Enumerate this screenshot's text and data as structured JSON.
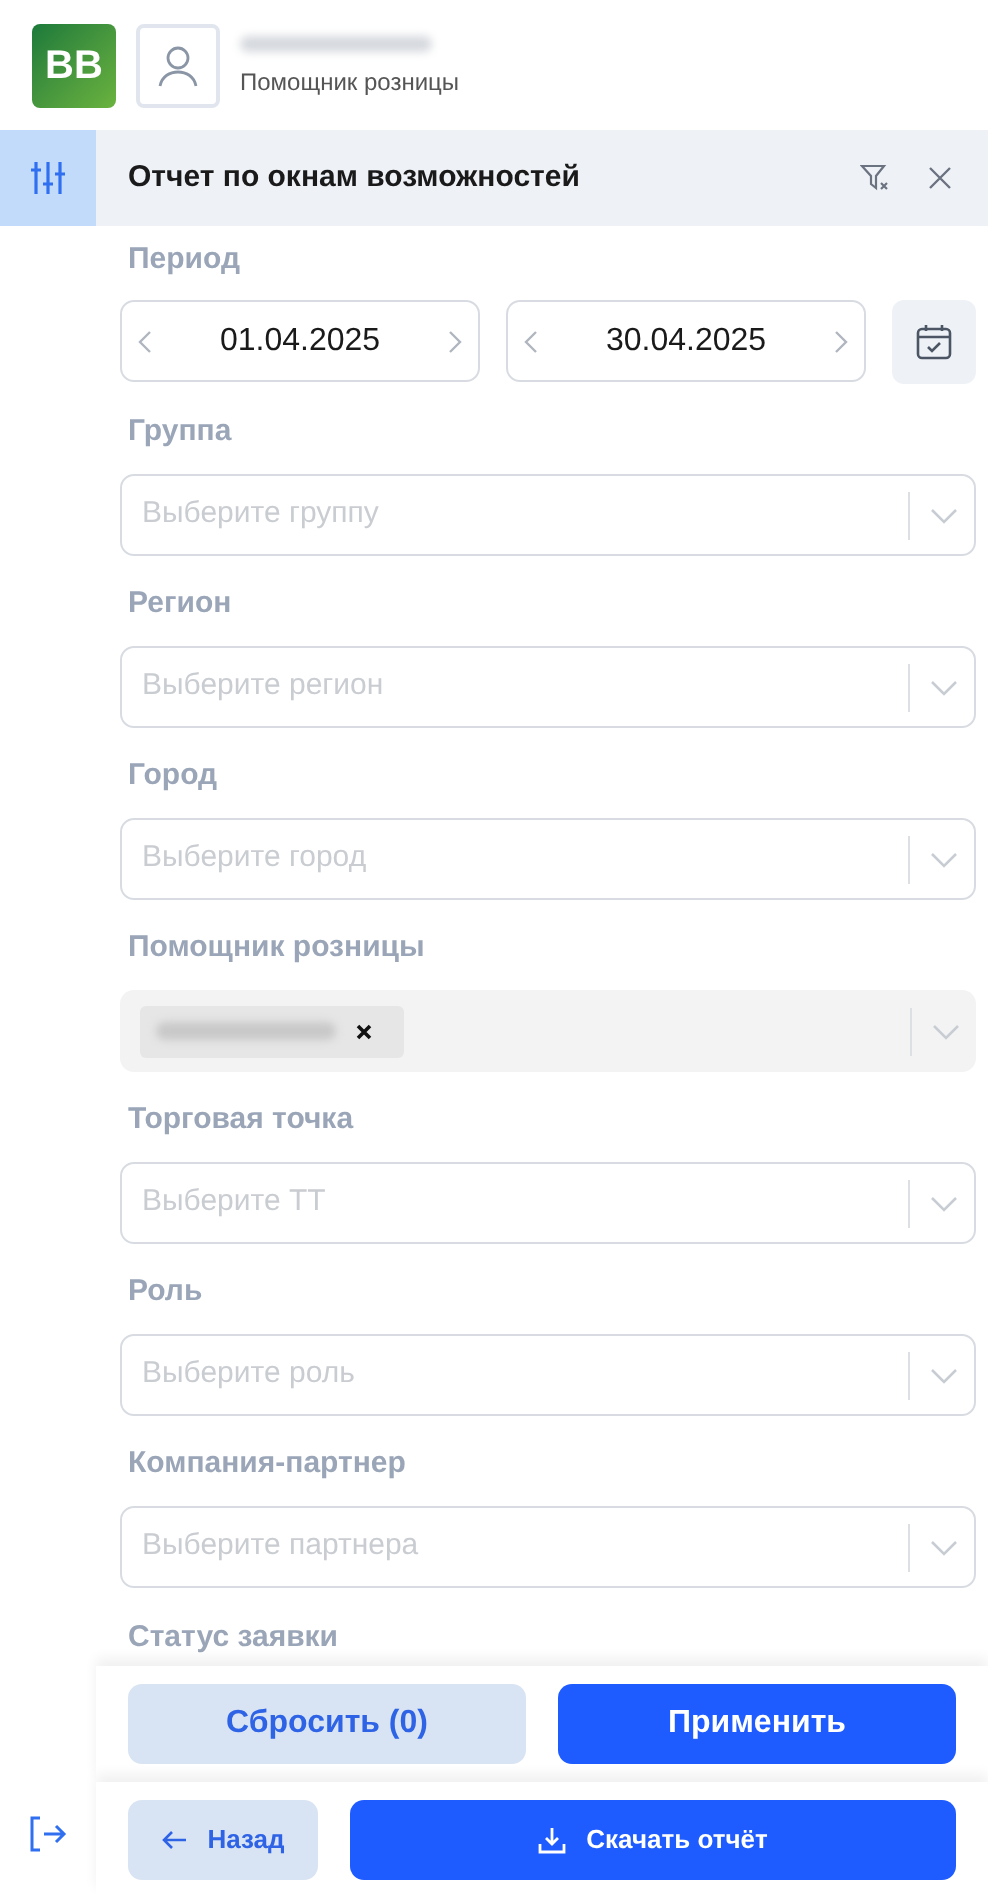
{
  "header": {
    "logo": "BB",
    "user_role": "Помощник розницы"
  },
  "panel": {
    "title": "Отчет по окнам возможностей"
  },
  "period": {
    "label": "Период",
    "from": "01.04.2025",
    "to": "30.04.2025"
  },
  "fields": [
    {
      "kind": "select",
      "label": "Группа",
      "placeholder": "Выберите группу",
      "disabled": false
    },
    {
      "kind": "select",
      "label": "Регион",
      "placeholder": "Выберите регион",
      "disabled": false
    },
    {
      "kind": "select",
      "label": "Город",
      "placeholder": "Выберите город",
      "disabled": false
    },
    {
      "kind": "chip",
      "label": "Помощник розницы",
      "disabled": true
    },
    {
      "kind": "select",
      "label": "Торговая точка",
      "placeholder": "Выберите ТТ",
      "disabled": false
    },
    {
      "kind": "select",
      "label": "Роль",
      "placeholder": "Выберите роль",
      "disabled": false
    },
    {
      "kind": "select",
      "label": "Компания-партнер",
      "placeholder": "Выберите партнера",
      "disabled": false
    },
    {
      "kind": "heading",
      "label": "Статус заявки"
    }
  ],
  "footer": {
    "reset": "Сбросить (0)",
    "apply": "Применить"
  },
  "bottom_bar": {
    "back": "Назад",
    "download": "Скачать отчёт"
  }
}
